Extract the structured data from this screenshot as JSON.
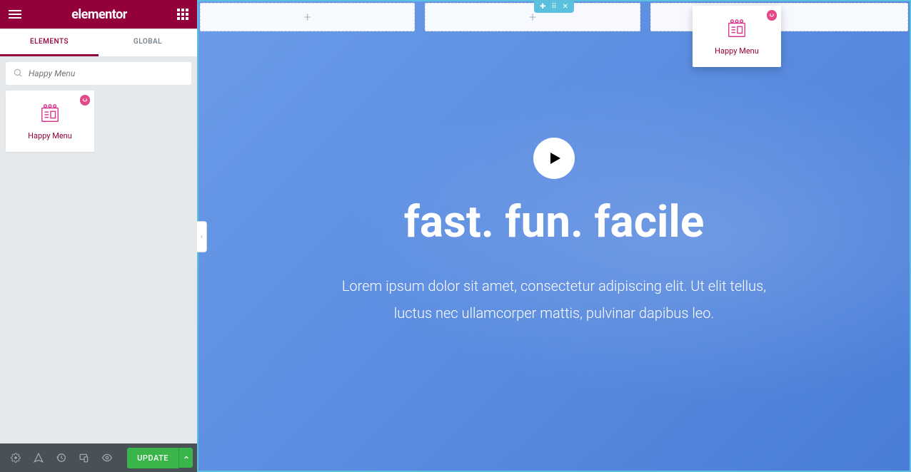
{
  "sidebar": {
    "logo": "elementor",
    "tabs": {
      "elements": "ELEMENTS",
      "global": "GLOBAL"
    },
    "search_placeholder": "Happy Menu",
    "widgets": [
      {
        "label": "Happy Menu",
        "icon": "happy-menu-icon"
      }
    ],
    "footer": {
      "update": "UPDATE"
    }
  },
  "canvas": {
    "hero": {
      "title": "fast. fun. facile",
      "desc": "Lorem ipsum dolor sit amet, consectetur adipiscing elit. Ut elit tellus, luctus nec ullamcorper mattis, pulvinar dapibus leo."
    },
    "dragging_widget": {
      "label": "Happy Menu"
    }
  },
  "colors": {
    "brand": "#93003C",
    "accent": "#5BC0DE",
    "green": "#39B54A"
  }
}
